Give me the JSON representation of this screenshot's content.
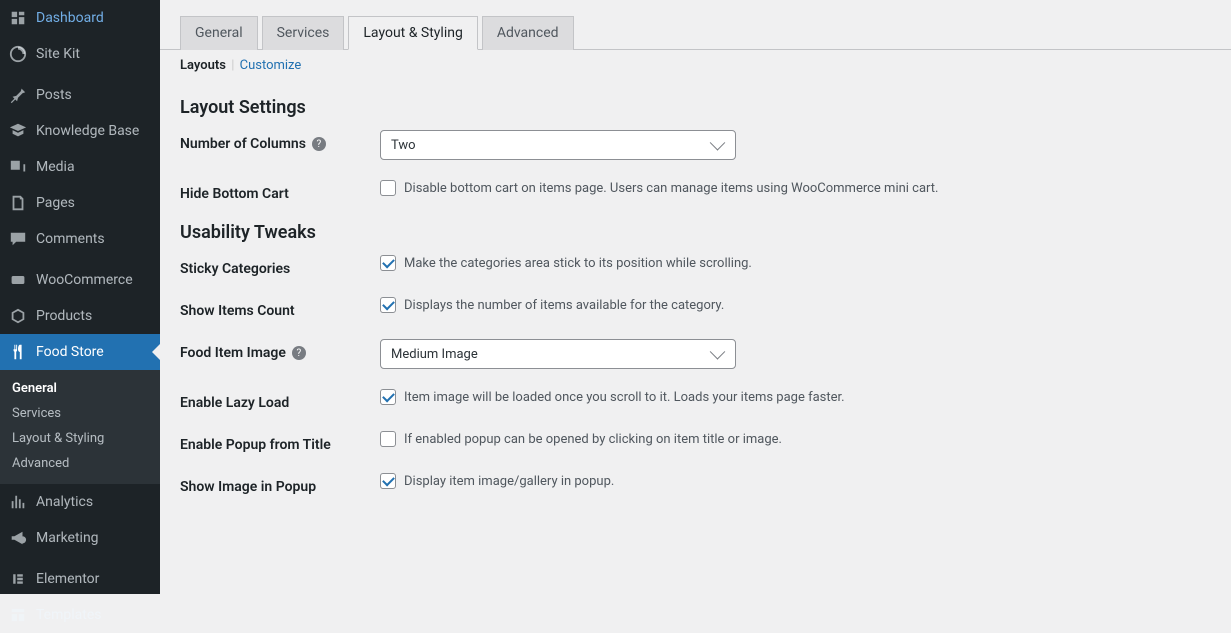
{
  "sidebar": {
    "items": [
      {
        "icon": "dashboard",
        "label": "Dashboard"
      },
      {
        "icon": "sitekit",
        "label": "Site Kit"
      },
      {
        "sep": true
      },
      {
        "icon": "pin",
        "label": "Posts"
      },
      {
        "icon": "kb",
        "label": "Knowledge Base"
      },
      {
        "icon": "media",
        "label": "Media"
      },
      {
        "icon": "pages",
        "label": "Pages"
      },
      {
        "icon": "comments",
        "label": "Comments"
      },
      {
        "sep": true
      },
      {
        "icon": "woo",
        "label": "WooCommerce"
      },
      {
        "icon": "products",
        "label": "Products"
      },
      {
        "icon": "food",
        "label": "Food Store",
        "active": true
      },
      {
        "submenu": true
      },
      {
        "icon": "analytics",
        "label": "Analytics"
      },
      {
        "icon": "marketing",
        "label": "Marketing"
      },
      {
        "sep": true
      },
      {
        "icon": "elementor",
        "label": "Elementor"
      },
      {
        "icon": "templates",
        "label": "Templates"
      }
    ],
    "submenu": [
      {
        "label": "General",
        "current": true
      },
      {
        "label": "Services"
      },
      {
        "label": "Layout & Styling"
      },
      {
        "label": "Advanced"
      }
    ]
  },
  "tabs": [
    {
      "label": "General"
    },
    {
      "label": "Services"
    },
    {
      "label": "Layout & Styling",
      "active": true
    },
    {
      "label": "Advanced"
    }
  ],
  "subsubsub": {
    "current": "Layouts",
    "link": "Customize"
  },
  "sectionA": {
    "title": "Layout Settings",
    "rows": [
      {
        "label": "Number of Columns",
        "help": true,
        "type": "select",
        "value": "Two"
      },
      {
        "label": "Hide Bottom Cart",
        "type": "checkbox",
        "checked": false,
        "desc": "Disable bottom cart on items page. Users can manage items using WooCommerce mini cart."
      }
    ]
  },
  "sectionB": {
    "title": "Usability Tweaks",
    "rows": [
      {
        "label": "Sticky Categories",
        "type": "checkbox",
        "checked": true,
        "desc": "Make the categories area stick to its position while scrolling."
      },
      {
        "label": "Show Items Count",
        "type": "checkbox",
        "checked": true,
        "desc": "Displays the number of items available for the category."
      },
      {
        "label": "Food Item Image",
        "help": true,
        "type": "select",
        "value": "Medium Image"
      },
      {
        "label": "Enable Lazy Load",
        "type": "checkbox",
        "checked": true,
        "desc": "Item image will be loaded once you scroll to it. Loads your items page faster."
      },
      {
        "label": "Enable Popup from Title",
        "type": "checkbox",
        "checked": false,
        "desc": "If enabled popup can be opened by clicking on item title or image."
      },
      {
        "label": "Show Image in Popup",
        "type": "checkbox",
        "checked": true,
        "desc": "Display item image/gallery in popup."
      }
    ]
  }
}
